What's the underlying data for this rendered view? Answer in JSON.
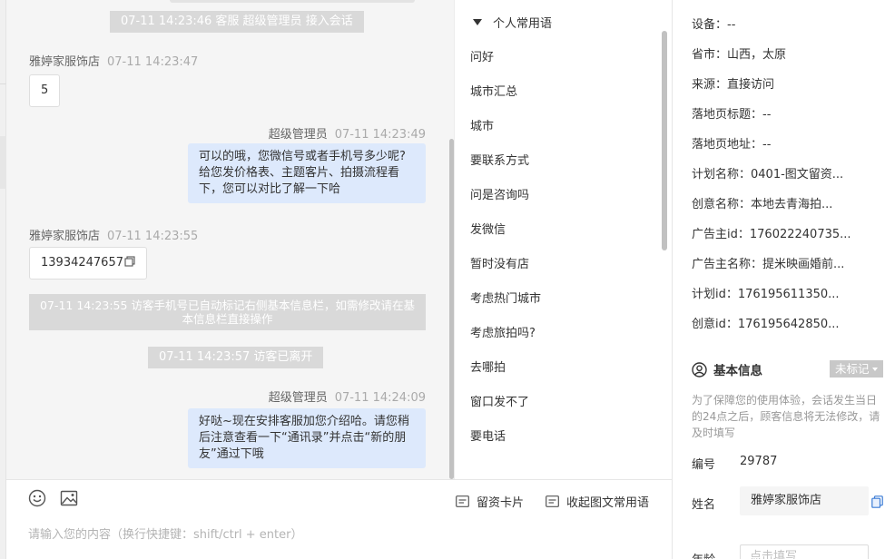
{
  "chat": {
    "messages": [
      {
        "kind": "system",
        "text": "07-11 14:23:46 客服 超级管理员 接入会话"
      },
      {
        "kind": "visitor",
        "sender": "雅婷家服饰店",
        "time": "07-11 14:23:47",
        "text": "5"
      },
      {
        "kind": "agent",
        "sender": "超级管理员",
        "time": "07-11 14:23:49",
        "text": "可以的哦，您微信号或者手机号多少呢?给您发价格表、主题客片、拍摄流程看下，您可以对比了解一下哈"
      },
      {
        "kind": "visitor",
        "sender": "雅婷家服饰店",
        "time": "07-11 14:23:55",
        "text": "13934247657"
      },
      {
        "kind": "system",
        "text": "07-11 14:23:55 访客手机号已自动标记右侧基本信息栏，如需修改请在基本信息栏直接操作"
      },
      {
        "kind": "system",
        "text": "07-11 14:23:57 访客已离开"
      },
      {
        "kind": "agent",
        "sender": "超级管理员",
        "time": "07-11 14:24:09",
        "text": "好哒~现在安排客服加您介绍哈。请您稍后注意查看一下“通讯录”并点击“新的朋友”通过下哦"
      }
    ]
  },
  "compose": {
    "emoji_icon": "emoji-icon",
    "image_icon": "image-icon",
    "lead_card_label": "留资卡片",
    "collapse_label": "收起图文常用语",
    "placeholder": "请输入您的内容（换行快捷键：shift/ctrl + enter）"
  },
  "phrases": {
    "header": "个人常用语",
    "items": [
      "问好",
      "城市汇总",
      "城市",
      "要联系方式",
      "问是咨询吗",
      "发微信",
      "暂时没有店",
      "考虑热门城市",
      "考虑旅拍吗?",
      "去哪拍",
      "窗口发不了",
      "要电话"
    ]
  },
  "info": {
    "rows": [
      {
        "label": "设备：",
        "value": "--"
      },
      {
        "label": "省市：",
        "value": "山西，太原"
      },
      {
        "label": "来源：",
        "value": "直接访问"
      },
      {
        "label": "落地页标题：",
        "value": "--"
      },
      {
        "label": "落地页地址：",
        "value": "--"
      },
      {
        "label": "计划名称：",
        "value": "0401-图文留资..."
      },
      {
        "label": "创意名称：",
        "value": "本地去青海拍..."
      },
      {
        "label": "广告主id：",
        "value": "176022240735..."
      },
      {
        "label": "广告主名称：",
        "value": "提米映画婚前..."
      },
      {
        "label": "计划id：",
        "value": "176195611350..."
      },
      {
        "label": "创意id：",
        "value": "176195642850..."
      }
    ],
    "basic": {
      "title": "基本信息",
      "tag": "未标记",
      "note": "为了保障您的使用体验，会话发生当日的24点之后，顾客信息将无法修改，请及时填写",
      "id_label": "编号",
      "id_value": "29787",
      "name_label": "姓名",
      "name_value": "雅婷家服饰店",
      "age_label": "年龄",
      "age_placeholder": "点击填写"
    }
  },
  "colors": {
    "agent_bubble": "#dde9fc",
    "system_pill": "#d9d9d9",
    "chat_bg": "#f5f5f5",
    "copy_blue": "#3a7bd5"
  }
}
